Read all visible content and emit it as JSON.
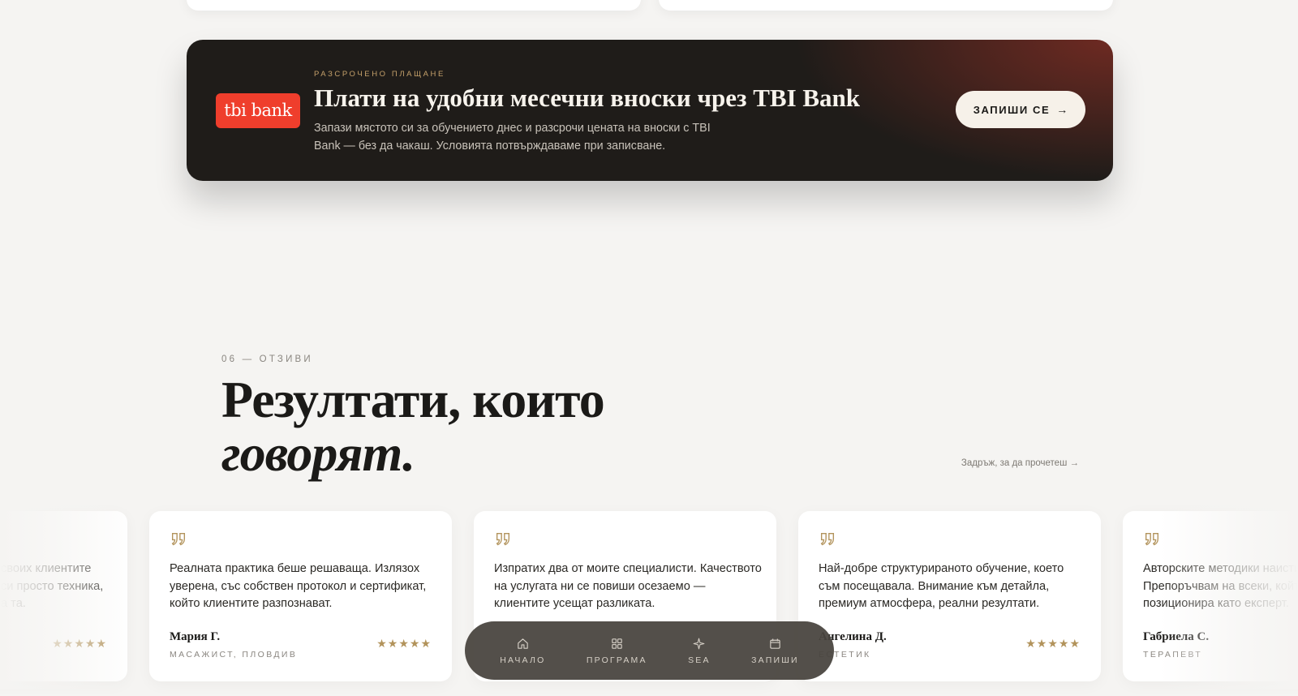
{
  "banner": {
    "logo_text": "tbi bank",
    "eyebrow": "РАЗСРОЧЕНО ПЛАЩАНЕ",
    "title": "Плати на удобни месечни вноски чрез TBI Bank",
    "description": "Запази мястото си за обучението днес и разсрочи цената на вноски с TBI Bank — без да чакаш. Условията потвърждаваме при записване.",
    "cta_label": "ЗАПИШИ СЕ",
    "cta_arrow": "→"
  },
  "testimonials": {
    "eyebrow": "06 — ОТЗИВИ",
    "title_line1": "Резултати, които",
    "title_line2": "говорят.",
    "drag_hint": "Задръж, за да прочетеш →",
    "cards": [
      {
        "text": "Реалната практика беше решаваща. Излязох уверена, със собствен протокол и сертификат, който клиентите разпознават.",
        "name": "Мария Г.",
        "role": "МАСАЖИСТ, ПЛОВДИВ",
        "stars": "★★★★★"
      },
      {
        "text": "Изпратих два от моите специалисти. Качеството на услугата ни се повиши осезаемо — клиентите усещат разликата.",
        "name": "",
        "role": "",
        "stars": ""
      },
      {
        "text": "Най-добре структурираното обучение, което съм посещавала. Внимание към детайла, премиум атмосфера, реални резултати.",
        "name": "Ангелина Д.",
        "role": "ЕСТЕТИК",
        "stars": "★★★★★"
      },
      {
        "text": "Авторските методики наистина се различават. Препоръчвам на всеки, който иска да се позиционира като експерт.",
        "name": "Габриела С.",
        "role": "ТЕРАПЕВТ",
        "stars": ""
      }
    ],
    "partial_card": {
      "text": "своих клиентите си просто техника, а та.",
      "stars": "★★★★★"
    }
  },
  "bottom_nav": {
    "items": [
      {
        "label": "НАЧАЛО",
        "icon": "home-icon"
      },
      {
        "label": "ПРОГРАМА",
        "icon": "grid-icon"
      },
      {
        "label": "SEA",
        "icon": "sparkle-icon"
      },
      {
        "label": "ЗАПИШИ",
        "icon": "calendar-icon"
      }
    ]
  },
  "colors": {
    "background": "#f5f4f2",
    "banner_dark": "#1f1c19",
    "banner_glow": "#6e2a22",
    "tbi_red": "#ef3e2c",
    "gold": "#b2935b",
    "nav_pill": "#48443f"
  }
}
